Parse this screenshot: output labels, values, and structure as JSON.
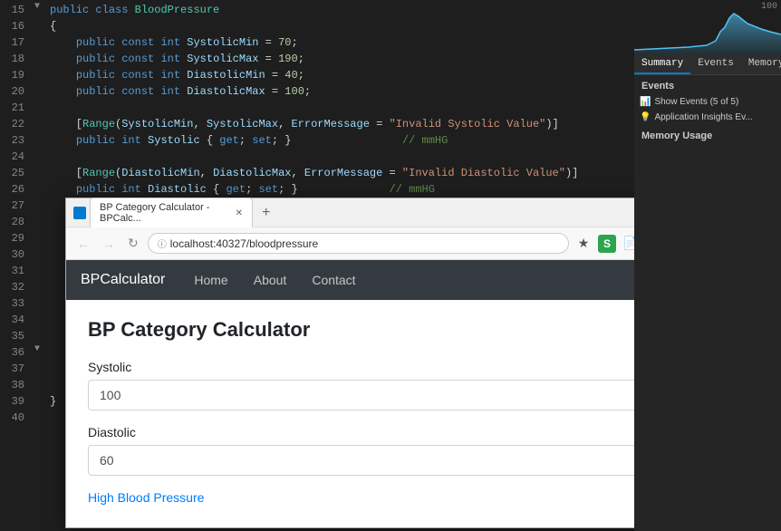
{
  "editor": {
    "lines": [
      {
        "num": 15,
        "content": "public class BloodPressure",
        "indent": 0
      },
      {
        "num": 16,
        "content": "{",
        "indent": 0
      },
      {
        "num": 17,
        "content": "    public const int SystolicMin = 70;",
        "indent": 1
      },
      {
        "num": 18,
        "content": "    public const int SystolicMax = 190;",
        "indent": 1
      },
      {
        "num": 19,
        "content": "    public const int DiastolicMin = 40;",
        "indent": 1
      },
      {
        "num": 20,
        "content": "    public const int DiastolicMax = 100;",
        "indent": 1
      },
      {
        "num": 21,
        "content": "",
        "indent": 0
      },
      {
        "num": 22,
        "content": "    [Range(SystolicMin, SystolicMax, ErrorMessage = \"Invalid Systolic Value\")]",
        "indent": 1
      },
      {
        "num": 23,
        "content": "    public int Systolic { get; set; }                // mmHG",
        "indent": 1
      },
      {
        "num": 24,
        "content": "",
        "indent": 0
      },
      {
        "num": 25,
        "content": "    [Range(DiastolicMin, DiastolicMax, ErrorMessage = \"Invalid Diastolic Value\")]",
        "indent": 1
      },
      {
        "num": 26,
        "content": "    public int Diastolic { get; set; }               // mmHG",
        "indent": 1
      },
      {
        "num": 27,
        "content": "",
        "indent": 0
      },
      {
        "num": 28,
        "content": "",
        "indent": 0
      },
      {
        "num": 29,
        "content": "",
        "indent": 0
      },
      {
        "num": 30,
        "content": "",
        "indent": 0
      },
      {
        "num": 31,
        "content": "",
        "indent": 0
      },
      {
        "num": 32,
        "content": "",
        "indent": 0
      },
      {
        "num": 33,
        "content": "",
        "indent": 0
      },
      {
        "num": 34,
        "content": "",
        "indent": 0
      },
      {
        "num": 35,
        "content": "",
        "indent": 0
      },
      {
        "num": 36,
        "content": "",
        "indent": 0
      },
      {
        "num": 37,
        "content": "",
        "indent": 0
      },
      {
        "num": 38,
        "content": "",
        "indent": 0
      },
      {
        "num": 39,
        "content": "}",
        "indent": 0
      },
      {
        "num": 40,
        "content": "",
        "indent": 0
      }
    ]
  },
  "rightPanel": {
    "chartLabel": "100",
    "tabs": [
      "Summary",
      "Events",
      "Memory"
    ],
    "activeTab": "Summary",
    "eventsTitle": "Events",
    "eventsCount": "Show Events (5 of 5)",
    "appInsightsText": "Application Insights Ev...",
    "memoryTitle": "Memory Usage"
  },
  "browser": {
    "tabTitle": "BP Category Calculator - BPCalc...",
    "newTabIcon": "+",
    "url": "localhost:40327/bloodpressure",
    "minBtn": "—",
    "maxBtn": "□",
    "closeBtn": "✕"
  },
  "app": {
    "brand": "BPCalculator",
    "navLinks": [
      "Home",
      "About",
      "Contact"
    ],
    "pageTitle": "BP Category Calculator",
    "systolicLabel": "Systolic",
    "systolicValue": "100",
    "diastolicLabel": "Diastolic",
    "diastolicValue": "60",
    "result": "High Blood Pressure"
  }
}
